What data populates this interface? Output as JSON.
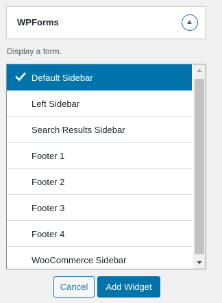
{
  "widget": {
    "title": "WPForms",
    "description": "Display a form."
  },
  "sidebar_list": {
    "items": [
      {
        "label": "Default Sidebar",
        "selected": true
      },
      {
        "label": "Left Sidebar",
        "selected": false
      },
      {
        "label": "Search Results Sidebar",
        "selected": false
      },
      {
        "label": "Footer 1",
        "selected": false
      },
      {
        "label": "Footer 2",
        "selected": false
      },
      {
        "label": "Footer 3",
        "selected": false
      },
      {
        "label": "Footer 4",
        "selected": false
      },
      {
        "label": "WooCommerce Sidebar",
        "selected": false
      }
    ]
  },
  "buttons": {
    "cancel_label": "Cancel",
    "add_label": "Add Widget"
  },
  "colors": {
    "accent": "#0073aa",
    "selected_text": "#ffffff",
    "background": "#f1f1f1"
  },
  "icons": {
    "toggle": "chevron-up-icon",
    "selected": "checkmark-icon",
    "scroll_up": "scroll-up-arrow-icon",
    "scroll_down": "scroll-down-arrow-icon"
  }
}
